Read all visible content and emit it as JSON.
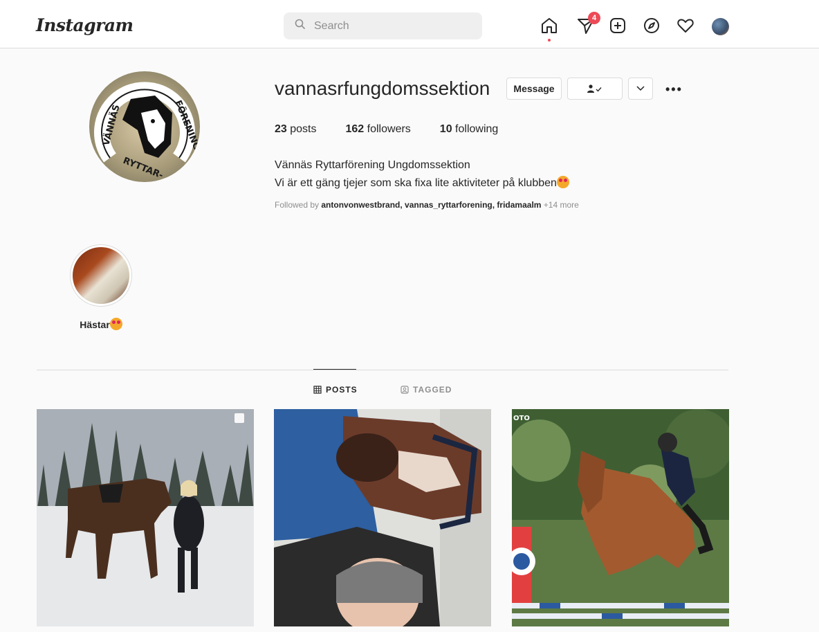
{
  "app": {
    "logo": "Instagram"
  },
  "search": {
    "placeholder": "Search"
  },
  "nav": {
    "direct_badge": "4"
  },
  "profile": {
    "username": "vannasrfungdomssektion",
    "message_label": "Message",
    "posts_count": "23",
    "posts_label": "posts",
    "followers_count": "162",
    "followers_label": "followers",
    "following_count": "10",
    "following_label": "following",
    "bio_name": "Vännäs Ryttarförening Ungdomssektion",
    "bio_text": "Vi är ett gäng tjejer som ska fixa lite aktiviteter på klubben",
    "followed_prefix": "Followed by",
    "followed_users": "antonvonwestbrand, vannas_ryttarforening, fridamaalm",
    "followed_more": "+14 more",
    "logo_top": "VÄNNÄS",
    "logo_right": "FÖRENING",
    "logo_bottom": "RYTTAR-"
  },
  "highlights": [
    {
      "label": "Hästar"
    }
  ],
  "tabs": [
    {
      "label": "POSTS",
      "active": true
    },
    {
      "label": "TAGGED",
      "active": false
    }
  ],
  "posts": [
    {
      "kind": "snow-horse",
      "multi": true
    },
    {
      "kind": "horse-selfie",
      "multi": false
    },
    {
      "kind": "show-jumping",
      "multi": false,
      "watermark": "OTO"
    }
  ]
}
